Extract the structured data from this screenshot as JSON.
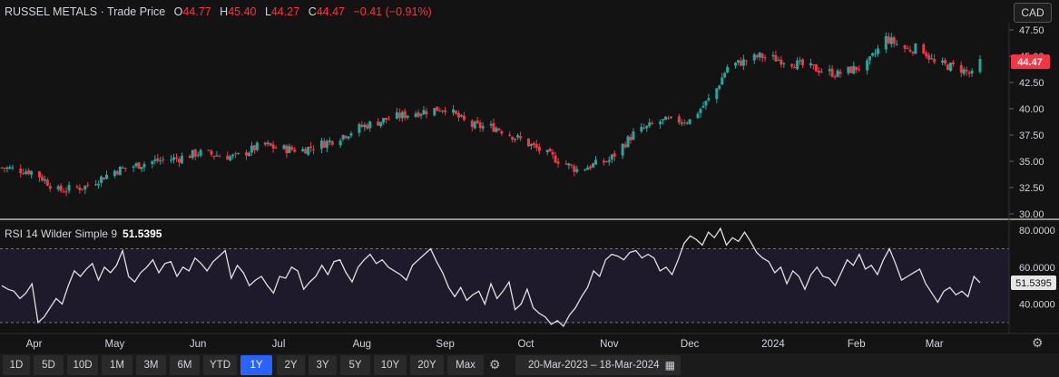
{
  "header": {
    "symbol": "RUSSEL METALS",
    "sep": "·",
    "price_label": "Trade Price",
    "open_label": "O",
    "open": "44.77",
    "high_label": "H",
    "high": "45.40",
    "low_label": "L",
    "low": "44.27",
    "close_label": "C",
    "close": "44.47",
    "change": "−0.41",
    "change_pct": "(−0.91%)"
  },
  "currency": "CAD",
  "last_price_tag": "44.47",
  "rsi": {
    "label": "RSI 14 Wilder Simple 9",
    "value": "51.5395"
  },
  "ranges": [
    "1D",
    "5D",
    "10D",
    "1M",
    "3M",
    "6M",
    "YTD",
    "1Y",
    "2Y",
    "3Y",
    "5Y",
    "10Y",
    "20Y",
    "Max"
  ],
  "active_range": "1Y",
  "date_range": {
    "start": "20-Mar-2023",
    "sep": "–",
    "end": "18-Mar-2024"
  },
  "icons": [
    "settings-icon",
    "calendar-icon",
    "gear-icon"
  ],
  "colors": {
    "up": "#26a69a",
    "down": "#f23645",
    "rsi_line": "#e0e0e0",
    "rsi_band": "#1f1a2b",
    "active": "#2962ff"
  },
  "chart_data": [
    {
      "type": "candlestick",
      "title": "RUSSEL METALS · Trade Price",
      "x_labels": [
        "Apr",
        "May",
        "Jun",
        "Jul",
        "Aug",
        "Sep",
        "Oct",
        "Nov",
        "Dec",
        "2024",
        "Feb",
        "Mar"
      ],
      "y_ticks": [
        "47.50",
        "45.00",
        "42.50",
        "40.00",
        "37.50",
        "35.00",
        "32.50",
        "30.00"
      ],
      "ylim": [
        30,
        47.5
      ],
      "grid": false,
      "close_path": [
        [
          "20-Mar-2023",
          34.4
        ],
        [
          "01-Apr-2023",
          34.0
        ],
        [
          "10-Apr-2023",
          32.2
        ],
        [
          "20-Apr-2023",
          32.6
        ],
        [
          "01-May-2023",
          34.1
        ],
        [
          "15-May-2023",
          35.0
        ],
        [
          "25-May-2023",
          35.3
        ],
        [
          "01-Jun-2023",
          35.8
        ],
        [
          "15-Jun-2023",
          35.4
        ],
        [
          "25-Jun-2023",
          36.6
        ],
        [
          "01-Jul-2023",
          36.2
        ],
        [
          "10-Jul-2023",
          36.1
        ],
        [
          "20-Jul-2023",
          36.9
        ],
        [
          "01-Aug-2023",
          38.3
        ],
        [
          "10-Aug-2023",
          39.0
        ],
        [
          "20-Aug-2023",
          39.6
        ],
        [
          "01-Sep-2023",
          40.1
        ],
        [
          "10-Sep-2023",
          38.4
        ],
        [
          "20-Sep-2023",
          38.2
        ],
        [
          "01-Oct-2023",
          36.8
        ],
        [
          "10-Oct-2023",
          35.5
        ],
        [
          "20-Oct-2023",
          34.2
        ],
        [
          "01-Nov-2023",
          35.1
        ],
        [
          "10-Nov-2023",
          37.6
        ],
        [
          "20-Nov-2023",
          38.8
        ],
        [
          "01-Dec-2023",
          38.9
        ],
        [
          "10-Dec-2023",
          41.4
        ],
        [
          "15-Dec-2023",
          44.0
        ],
        [
          "27-Dec-2023",
          45.0
        ],
        [
          "05-Jan-2024",
          44.6
        ],
        [
          "15-Jan-2024",
          43.9
        ],
        [
          "25-Jan-2024",
          43.3
        ],
        [
          "05-Feb-2024",
          44.2
        ],
        [
          "12-Feb-2024",
          46.7
        ],
        [
          "20-Feb-2024",
          45.6
        ],
        [
          "25-Feb-2024",
          45.9
        ],
        [
          "01-Mar-2024",
          44.3
        ],
        [
          "10-Mar-2024",
          43.9
        ],
        [
          "15-Mar-2024",
          43.2
        ],
        [
          "18-Mar-2024",
          44.47
        ]
      ]
    },
    {
      "type": "line",
      "title": "RSI 14 Wilder Simple 9",
      "x_labels": [
        "Apr",
        "May",
        "Jun",
        "Jul",
        "Aug",
        "Sep",
        "Oct",
        "Nov",
        "Dec",
        "2024",
        "Feb",
        "Mar"
      ],
      "y_ticks": [
        "80.0000",
        "60.0000",
        "40.0000"
      ],
      "ylim": [
        25,
        85
      ],
      "bands": [
        30,
        70
      ],
      "values": [
        50,
        48,
        47,
        43,
        46,
        51,
        30,
        33,
        38,
        43,
        40,
        50,
        58,
        55,
        59,
        62,
        53,
        60,
        57,
        61,
        69,
        55,
        52,
        57,
        60,
        64,
        57,
        62,
        63,
        55,
        60,
        58,
        65,
        62,
        58,
        63,
        66,
        69,
        54,
        61,
        57,
        50,
        53,
        55,
        50,
        46,
        55,
        54,
        60,
        58,
        48,
        52,
        55,
        61,
        56,
        63,
        64,
        57,
        52,
        60,
        64,
        67,
        62,
        64,
        60,
        58,
        56,
        53,
        61,
        64,
        67,
        70,
        63,
        57,
        49,
        44,
        49,
        42,
        45,
        47,
        40,
        51,
        43,
        47,
        52,
        37,
        40,
        48,
        38,
        35,
        33,
        29,
        31,
        28,
        34,
        38,
        44,
        49,
        58,
        55,
        64,
        67,
        66,
        64,
        68,
        69,
        65,
        67,
        65,
        58,
        60,
        56,
        64,
        73,
        77,
        75,
        72,
        79,
        76,
        81,
        72,
        76,
        74,
        79,
        74,
        68,
        65,
        63,
        57,
        60,
        51,
        58,
        55,
        48,
        56,
        60,
        55,
        54,
        50,
        57,
        64,
        61,
        67,
        59,
        61,
        56,
        64,
        70,
        62,
        53,
        55,
        57,
        59,
        51,
        46,
        41,
        47,
        49,
        45,
        47,
        44,
        55,
        51.5395
      ]
    }
  ]
}
